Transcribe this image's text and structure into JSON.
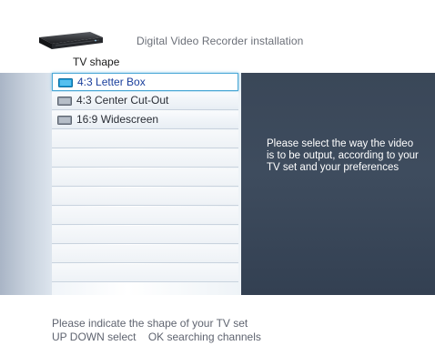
{
  "header": {
    "app_title": "Digital Video Recorder installation",
    "page_title": "TV shape",
    "device_icon": "dvr-device-icon"
  },
  "options": [
    {
      "label": "4:3 Letter Box",
      "selected": true,
      "icon": "tv-icon"
    },
    {
      "label": "4:3 Center Cut-Out",
      "selected": false,
      "icon": "tv-icon"
    },
    {
      "label": "16:9 Widescreen",
      "selected": false,
      "icon": "tv-icon"
    }
  ],
  "info_panel": {
    "text": "Please select the way the video is to be output, according to your TV set and your preferences"
  },
  "footer": {
    "hint": "Please indicate the shape of your TV set",
    "keys_nav": "UP DOWN select",
    "keys_ok": "OK searching channels"
  },
  "colors": {
    "accent": "#4aa8d6",
    "selected_text": "#1a3f9c",
    "panel": "#3a4758",
    "icon_selected": "#1d9ad6",
    "icon_default": "#8d96a3"
  }
}
